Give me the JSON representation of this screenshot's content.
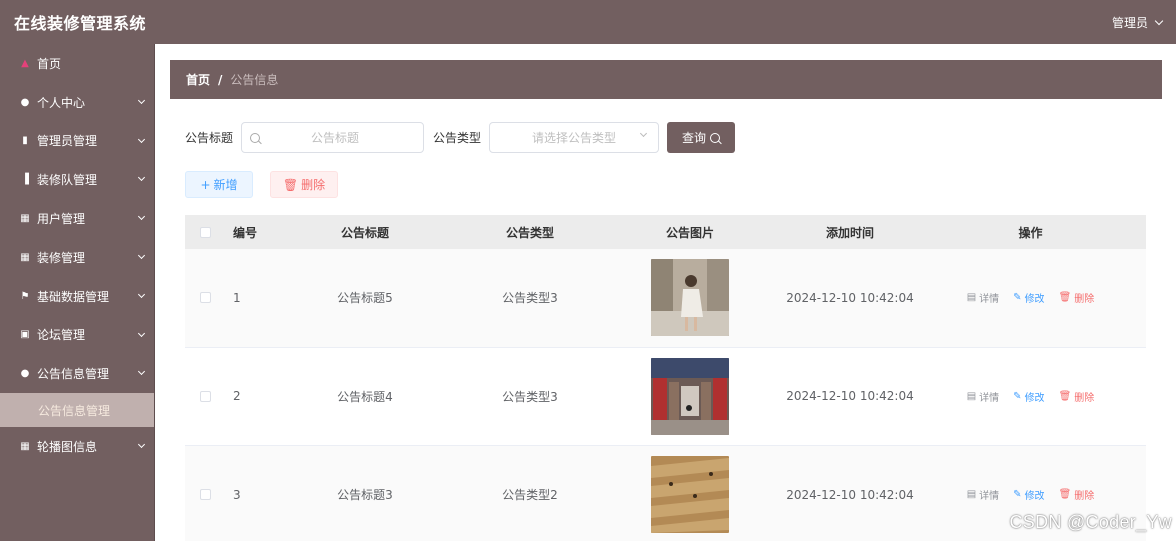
{
  "header": {
    "app_title": "在线装修管理系统",
    "user_label": "管理员"
  },
  "sidebar": {
    "items": [
      {
        "label": "首页",
        "icon": "home-icon"
      },
      {
        "label": "个人中心",
        "icon": "user-icon"
      },
      {
        "label": "管理员管理",
        "icon": "clipboard-icon"
      },
      {
        "label": "装修队管理",
        "icon": "library-icon"
      },
      {
        "label": "用户管理",
        "icon": "grid-icon"
      },
      {
        "label": "装修管理",
        "icon": "grid-icon"
      },
      {
        "label": "基础数据管理",
        "icon": "flag-icon"
      },
      {
        "label": "论坛管理",
        "icon": "picture-icon"
      },
      {
        "label": "公告信息管理",
        "icon": "user-icon"
      },
      {
        "label": "轮播图信息",
        "icon": "grid-icon"
      }
    ],
    "active_submenu": "公告信息管理"
  },
  "breadcrumb": {
    "home": "首页",
    "separator": "/",
    "current": "公告信息"
  },
  "search": {
    "title_label": "公告标题",
    "title_placeholder": "公告标题",
    "type_label": "公告类型",
    "type_placeholder": "请选择公告类型",
    "query_button": "查询"
  },
  "toolbar": {
    "add_button": "新增",
    "delete_button": "删除"
  },
  "table": {
    "headers": {
      "id": "编号",
      "title": "公告标题",
      "type": "公告类型",
      "image": "公告图片",
      "time": "添加时间",
      "ops": "操作"
    },
    "rows": [
      {
        "id": "1",
        "title": "公告标题5",
        "type": "公告类型3",
        "time": "2024-12-10 10:42:04"
      },
      {
        "id": "2",
        "title": "公告标题4",
        "type": "公告类型3",
        "time": "2024-12-10 10:42:04"
      },
      {
        "id": "3",
        "title": "公告标题3",
        "type": "公告类型2",
        "time": "2024-12-10 10:42:04"
      }
    ],
    "ops": {
      "detail": "详情",
      "edit": "修改",
      "delete": "删除"
    }
  },
  "watermark": "CSDN @Coder_Yw",
  "colors": {
    "brand": "#725f60",
    "submenu_active_bg": "#c0b0ae",
    "primary": "#409eff",
    "danger": "#f56c6c"
  }
}
